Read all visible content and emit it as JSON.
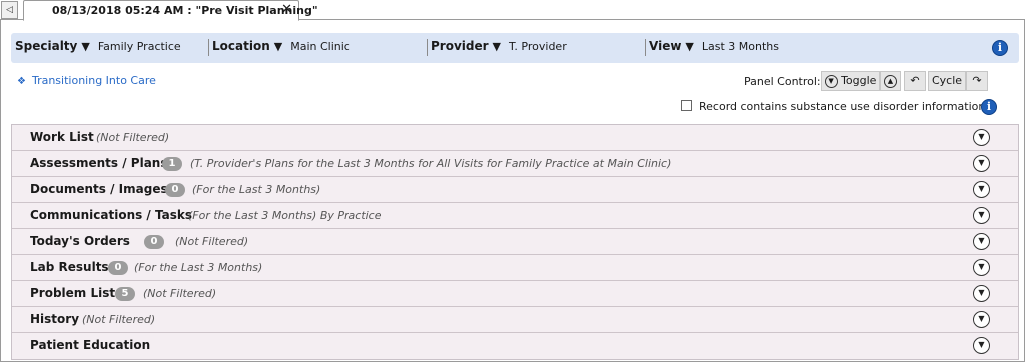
{
  "tab": {
    "scroll_glyph": "◁",
    "title": "08/13/2018 05:24 AM : \"Pre Visit Planning\"",
    "close_glyph": "✕"
  },
  "filters": {
    "specialty": {
      "label": "Specialty",
      "value": "Family Practice"
    },
    "location": {
      "label": "Location",
      "value": "Main Clinic"
    },
    "provider": {
      "label": "Provider",
      "value": "T. Provider"
    },
    "view": {
      "label": "View",
      "value": "Last 3 Months"
    },
    "caret": "▼"
  },
  "icons": {
    "info": "info-icon",
    "info_glyph": "i",
    "expand_glyph": "▼",
    "collapse_glyph": "▲",
    "back_glyph": "↶",
    "cycle_glyph": "↷"
  },
  "care_link": {
    "diamond": "❖",
    "label": "Transitioning Into Care"
  },
  "panel_control": {
    "label": "Panel Control:",
    "toggle": "Toggle",
    "cycle": "Cycle"
  },
  "substance": {
    "label": "Record contains substance use disorder information",
    "checked": false
  },
  "panels": [
    {
      "title": "Work List",
      "badge": "",
      "desc": "(Not Filtered)"
    },
    {
      "title": "Assessments / Plans",
      "badge": "1",
      "desc": "(T. Provider's Plans for the Last 3 Months for All Visits for Family Practice at Main Clinic)"
    },
    {
      "title": "Documents / Images",
      "badge": "0",
      "desc": "(For the Last 3 Months)"
    },
    {
      "title": "Communications / Tasks",
      "badge": "",
      "desc": "(For the Last 3 Months) By Practice"
    },
    {
      "title": "Today's Orders",
      "badge": "0",
      "desc": "(Not Filtered)"
    },
    {
      "title": "Lab Results",
      "badge": "0",
      "desc": "(For the Last 3 Months)"
    },
    {
      "title": "Problem List",
      "badge": "5",
      "desc": "(Not Filtered)"
    },
    {
      "title": "History",
      "badge": "",
      "desc": "(Not Filtered)"
    },
    {
      "title": "Patient Education",
      "badge": "",
      "desc": ""
    }
  ]
}
